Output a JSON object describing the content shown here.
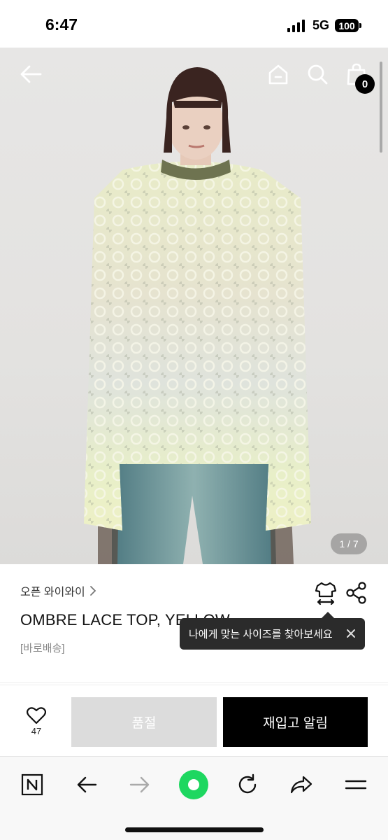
{
  "status_bar": {
    "time": "6:47",
    "network": "5G",
    "battery": "100"
  },
  "header": {
    "back_icon": "arrow-left-icon",
    "home_icon": "home-icon",
    "search_icon": "search-icon",
    "cart_icon": "shopping-bag-icon",
    "cart_count": "0"
  },
  "gallery": {
    "page_indicator": "1 / 7",
    "current_page": 1,
    "total_pages": 7
  },
  "product": {
    "brand": "오픈 와이와이",
    "title": "OMBRE LACE TOP, YELLOW",
    "delivery_tag": "[바로배송]"
  },
  "tooltip": {
    "text": "나에게 맞는 사이즈를 찾아보세요"
  },
  "purchase_bar": {
    "like_count": "47",
    "soldout_label": "품절",
    "restock_label": "재입고 알림"
  },
  "browser_toolbar": {
    "icons": [
      "naver-n-icon",
      "arrow-left-icon",
      "arrow-right-icon",
      "green-dot-icon",
      "refresh-icon",
      "share-arrow-icon",
      "menu-icon"
    ]
  },
  "colors": {
    "accent_green": "#1ed760",
    "dark": "#000000",
    "tooltip_bg": "#2b2b2b",
    "soldout_bg": "#dcdcdc"
  }
}
